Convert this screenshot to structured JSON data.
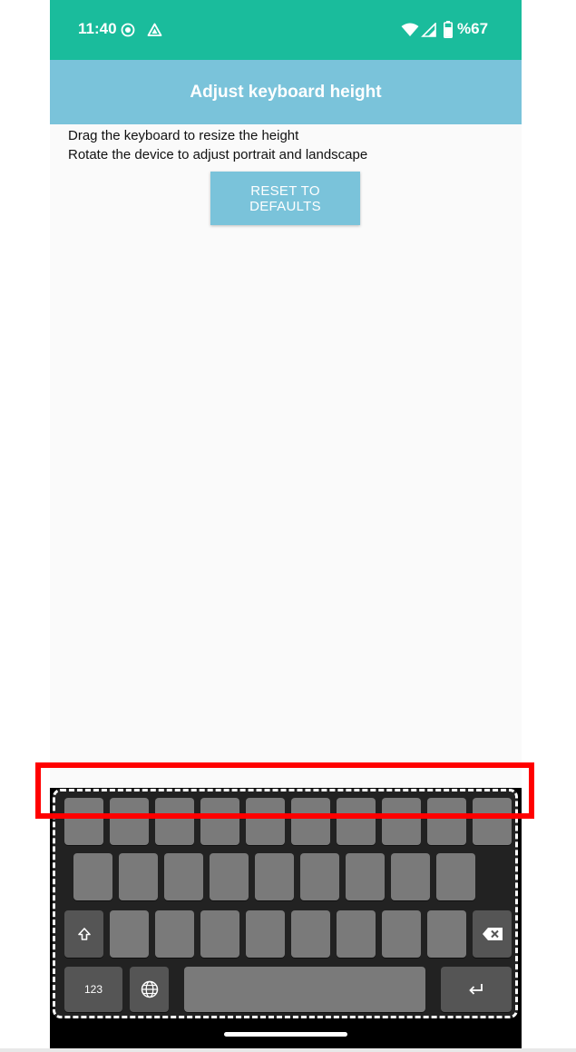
{
  "status_bar": {
    "time": "11:40",
    "battery_text": "%67",
    "icons": [
      "record-icon",
      "drive-icon",
      "wifi-icon",
      "signal-icon",
      "battery-icon"
    ]
  },
  "app_bar": {
    "title": "Adjust keyboard height"
  },
  "instructions": {
    "line1": "Drag the keyboard to resize the height",
    "line2": "Rotate the device to adjust portrait and landscape"
  },
  "reset_button": {
    "label": "RESET TO DEFAULTS"
  },
  "keyboard": {
    "numbers_key_label": "123",
    "special_keys": [
      "shift-icon",
      "backspace-icon",
      "globe-icon",
      "enter-icon"
    ]
  },
  "colors": {
    "status_bar": "#1abc9c",
    "app_bar": "#7ac3da",
    "highlight": "#ff0000"
  }
}
